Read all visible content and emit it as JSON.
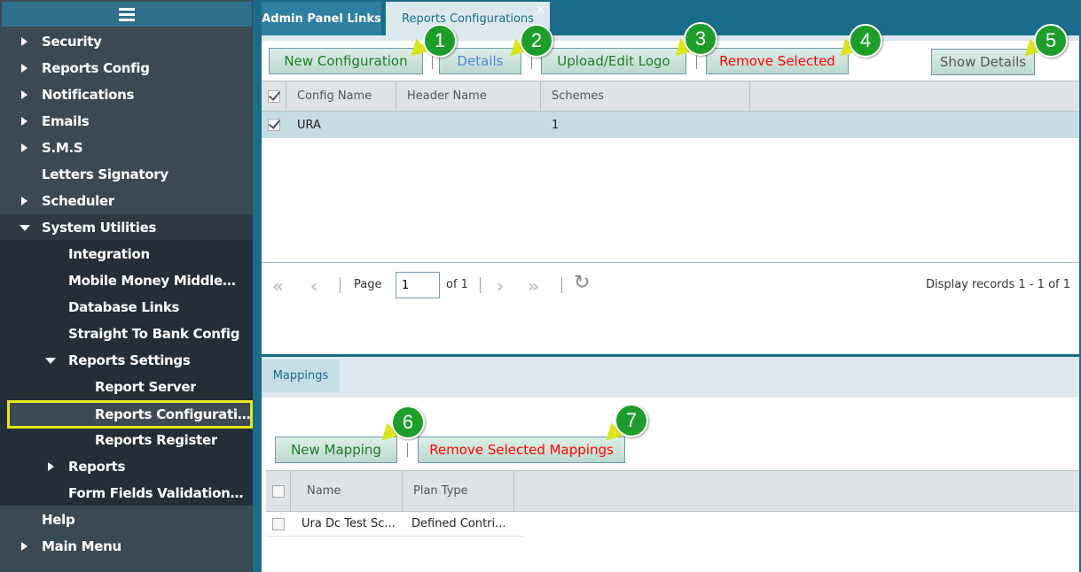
{
  "sidebar": {
    "items": [
      {
        "label": "Security"
      },
      {
        "label": "Reports Config"
      },
      {
        "label": "Notifications"
      },
      {
        "label": "Emails"
      },
      {
        "label": "S.M.S"
      },
      {
        "label": "Letters Signatory"
      },
      {
        "label": "Scheduler"
      },
      {
        "label": "System Utilities"
      },
      {
        "label": "Integration"
      },
      {
        "label": "Mobile Money Middleware..."
      },
      {
        "label": "Database Links"
      },
      {
        "label": "Straight To Bank Config"
      },
      {
        "label": "Reports Settings"
      },
      {
        "label": "Report Server"
      },
      {
        "label": "Reports Configurations"
      },
      {
        "label": "Reports Register"
      },
      {
        "label": "Reports"
      },
      {
        "label": "Form Fields Validation Mat..."
      },
      {
        "label": "Help"
      },
      {
        "label": "Main Menu"
      }
    ]
  },
  "tabs": {
    "admin": "Admin Panel Links",
    "reports": "Reports Configurations",
    "close": "×"
  },
  "toolbar": {
    "new_configuration": "New Configuration",
    "details": "Details",
    "upload_logo": "Upload/Edit Logo",
    "remove_selected": "Remove Selected",
    "show_details": "Show Details"
  },
  "config_grid": {
    "columns": [
      "Config Name",
      "Header Name",
      "Schemes"
    ],
    "rows": [
      {
        "config_name": "URA",
        "header_name": "",
        "schemes": "1"
      }
    ]
  },
  "pager": {
    "page_label": "Page",
    "page_value": "1",
    "of_label": "of 1",
    "display": "Display records 1 - 1 of 1"
  },
  "mappings": {
    "tab": "Mappings",
    "new_mapping": "New Mapping",
    "remove_selected": "Remove Selected Mappings",
    "columns": [
      "Name",
      "Plan Type"
    ],
    "rows": [
      {
        "name": "Ura Dc Test Sc...",
        "plan_type": "Defined Contri..."
      }
    ]
  },
  "callouts": [
    "1",
    "2",
    "3",
    "4",
    "5",
    "6",
    "7"
  ],
  "colors": {
    "sidebar_bg": "#3a4a55",
    "header_teal": "#1b6c8a",
    "callout_green": "#1f9d2a",
    "highlight_yellow": "#e8e81a"
  }
}
